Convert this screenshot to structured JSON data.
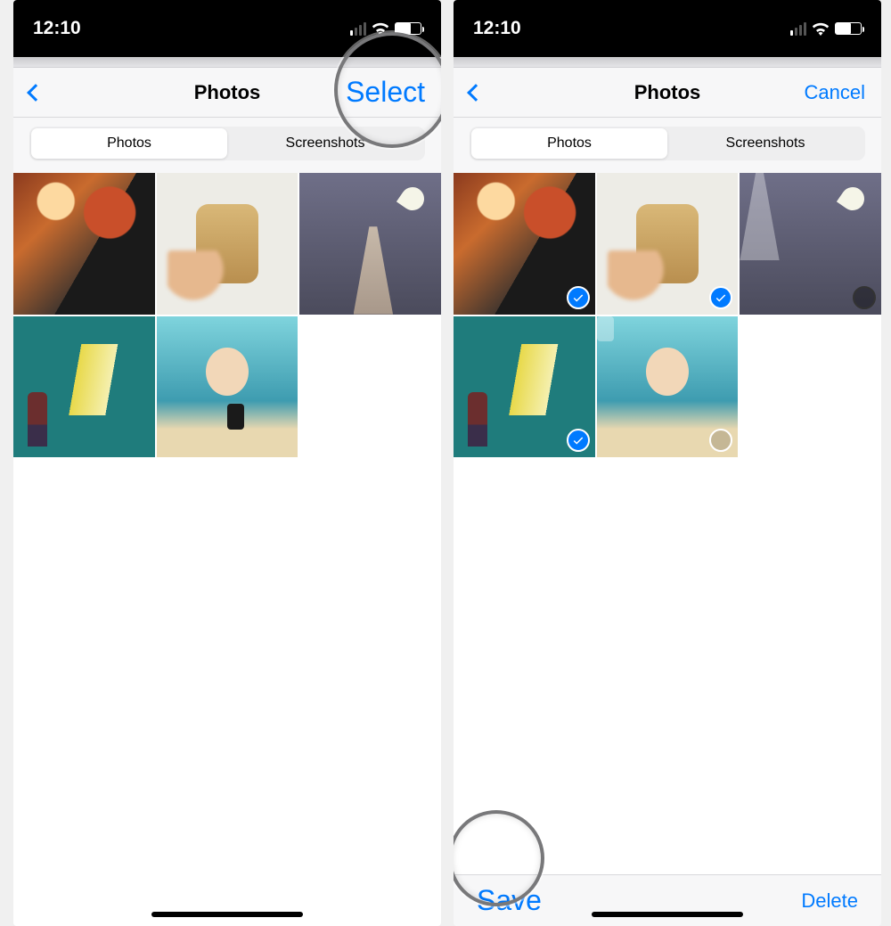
{
  "status": {
    "time": "12:10"
  },
  "left": {
    "nav": {
      "title": "Photos",
      "action": "Select"
    },
    "segments": {
      "photos": "Photos",
      "screenshots": "Screenshots",
      "active": "photos"
    }
  },
  "right": {
    "nav": {
      "title": "Photos",
      "action": "Cancel"
    },
    "segments": {
      "photos": "Photos",
      "screenshots": "Screenshots",
      "active": "photos"
    },
    "toolbar": {
      "save": "Save",
      "delete": "Delete"
    },
    "thumbs": [
      {
        "selected": true
      },
      {
        "selected": true
      },
      {
        "selected": false,
        "dark_ring": true
      },
      {
        "selected": true
      },
      {
        "selected": false
      }
    ]
  }
}
